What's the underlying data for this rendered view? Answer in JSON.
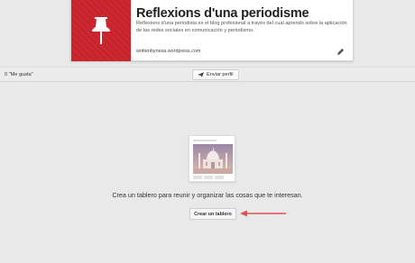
{
  "profile": {
    "name": "Reflexions d'una periodisme",
    "about": "Reflexions d'una periodista es el blog profesional a través del cual aprendo sobre la aplicación de las redes sociales en comunicación y periodismo.",
    "website": "writtenbynesa.wordpress.com",
    "edit_icon": "pencil-icon",
    "avatar_icon": "pushpin-icon",
    "avatar_color": "#c8232c"
  },
  "toolbar": {
    "likes_label": "0 \"Me gusta\"",
    "send_profile_label": "Enviar perfil",
    "send_icon": "paper-plane-icon"
  },
  "empty_state": {
    "message": "Crea un tablero para reunir y organizar las cosas que te interesan.",
    "create_board_label": "Crear un tablero",
    "annotation_color": "#e0524f"
  }
}
